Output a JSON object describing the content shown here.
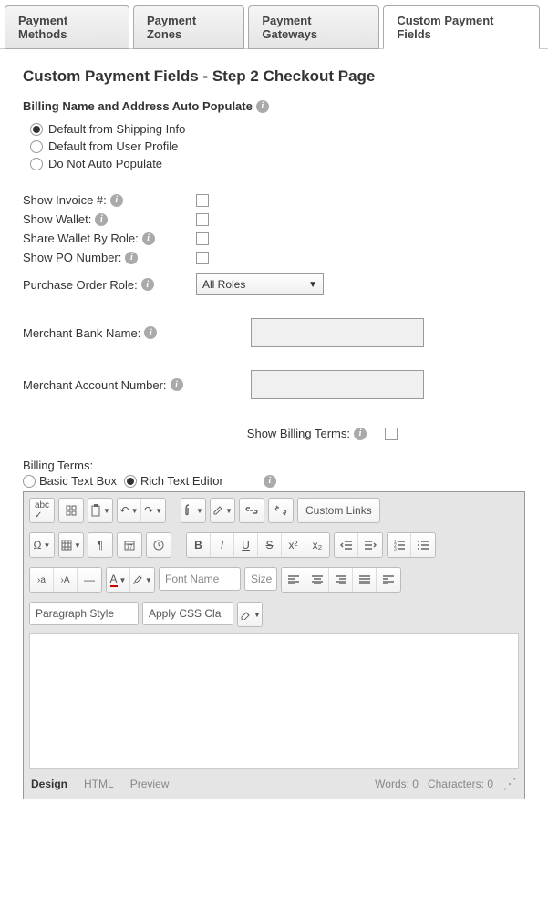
{
  "tabs": [
    "Payment Methods",
    "Payment Zones",
    "Payment Gateways",
    "Custom Payment Fields"
  ],
  "activeTab": 3,
  "heading": "Custom Payment Fields - Step 2 Checkout Page",
  "autopop": {
    "title": "Billing Name and Address Auto Populate",
    "options": [
      "Default from Shipping Info",
      "Default from User Profile",
      "Do Not Auto Populate"
    ],
    "selected": 0
  },
  "rows": {
    "show_invoice": "Show Invoice #:",
    "show_wallet": "Show Wallet:",
    "share_wallet": "Share Wallet By Role:",
    "show_po": "Show PO Number:",
    "po_role": "Purchase Order Role:",
    "po_role_value": "All Roles",
    "merchant_bank": "Merchant Bank Name:",
    "merchant_account": "Merchant Account Number:"
  },
  "show_billing_terms_label": "Show Billing Terms:",
  "billing_terms_label": "Billing Terms:",
  "bt_radios": {
    "basic": "Basic Text Box",
    "rich": "Rich Text Editor",
    "selected": 1
  },
  "toolbar": {
    "custom_links": "Custom Links",
    "font_name": "Font Name",
    "size": "Size",
    "paragraph_style": "Paragraph Style",
    "apply_css": "Apply CSS Cla"
  },
  "footer": {
    "tabs": [
      "Design",
      "HTML",
      "Preview"
    ],
    "active": 0,
    "words": "Words: 0",
    "chars": "Characters: 0"
  }
}
